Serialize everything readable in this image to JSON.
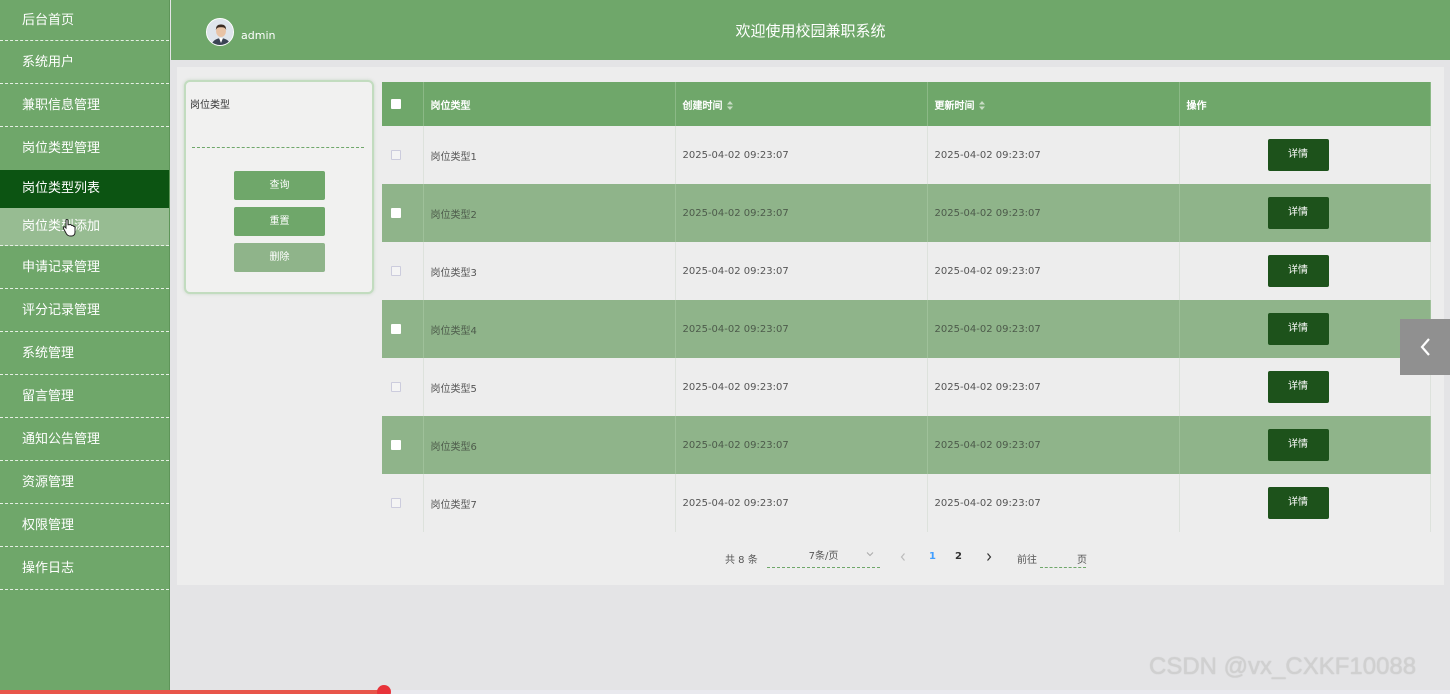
{
  "sidebar": {
    "items": [
      {
        "label": "后台首页"
      },
      {
        "label": "系统用户"
      },
      {
        "label": "兼职信息管理"
      },
      {
        "label": "岗位类型管理"
      },
      {
        "label": "岗位类型列表"
      },
      {
        "label": "岗位类型添加"
      },
      {
        "label": "申请记录管理"
      },
      {
        "label": "评分记录管理"
      },
      {
        "label": "系统管理"
      },
      {
        "label": "留言管理"
      },
      {
        "label": "通知公告管理"
      },
      {
        "label": "资源管理"
      },
      {
        "label": "权限管理"
      },
      {
        "label": "操作日志"
      }
    ]
  },
  "header": {
    "username": "admin",
    "title": "欢迎使用校园兼职系统"
  },
  "search": {
    "label": "岗位类型",
    "placeholder": "",
    "query_label": "查询",
    "reset_label": "重置",
    "delete_label": "删除"
  },
  "table": {
    "headers": [
      "岗位类型",
      "创建时间",
      "更新时间",
      "操作"
    ],
    "detail_label": "详情",
    "rows": [
      {
        "type": "岗位类型1",
        "created": "2025-04-02 09:23:07",
        "updated": "2025-04-02 09:23:07"
      },
      {
        "type": "岗位类型2",
        "created": "2025-04-02 09:23:07",
        "updated": "2025-04-02 09:23:07"
      },
      {
        "type": "岗位类型3",
        "created": "2025-04-02 09:23:07",
        "updated": "2025-04-02 09:23:07"
      },
      {
        "type": "岗位类型4",
        "created": "2025-04-02 09:23:07",
        "updated": "2025-04-02 09:23:07"
      },
      {
        "type": "岗位类型5",
        "created": "2025-04-02 09:23:07",
        "updated": "2025-04-02 09:23:07"
      },
      {
        "type": "岗位类型6",
        "created": "2025-04-02 09:23:07",
        "updated": "2025-04-02 09:23:07"
      },
      {
        "type": "岗位类型7",
        "created": "2025-04-02 09:23:07",
        "updated": "2025-04-02 09:23:07"
      }
    ]
  },
  "pagination": {
    "total": "共 8 条",
    "page_size": "7条/页",
    "pages": [
      "1",
      "2"
    ],
    "current": "1",
    "goto_label": "前往",
    "page_label": "页"
  },
  "watermark": "CSDN @vx_CXKF10088",
  "colors": {
    "primary": "#6fa76a",
    "active": "#0c5412",
    "stripe": "#8fb48a",
    "detail_button": "#1d521b"
  }
}
